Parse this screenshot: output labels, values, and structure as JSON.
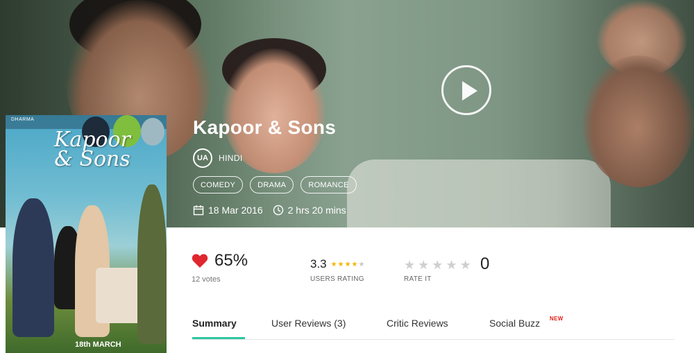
{
  "movie": {
    "title": "Kapoor & Sons",
    "certificate": "UA",
    "language": "HINDI",
    "genres": [
      "COMEDY",
      "DRAMA",
      "ROMANCE"
    ],
    "release_date": "18 Mar 2016",
    "duration": "2 hrs 20 mins"
  },
  "poster": {
    "logo_text": "DHARMA",
    "title_text": "Kapoor & Sons",
    "release_text": "18th MARCH"
  },
  "stats": {
    "like_percent": "65%",
    "votes": "12 votes",
    "user_rating_value": "3.3",
    "user_rating_label": "USERS RATING",
    "user_rating_stars": 3.3,
    "rate_it_label": "RATE IT",
    "rate_it_count": "0"
  },
  "tabs": {
    "summary": "Summary",
    "user_reviews": "User Reviews (3)",
    "critic_reviews": "Critic Reviews",
    "social_buzz": "Social Buzz",
    "new_badge": "NEW"
  },
  "icons": {
    "play": "play-icon",
    "calendar": "calendar-icon",
    "clock": "clock-icon",
    "heart": "heart-icon",
    "star": "star-icon"
  },
  "colors": {
    "accent": "#2dc8a0",
    "heart": "#e0262f",
    "star_gold": "#f2b600",
    "new_badge": "#e2231a"
  }
}
